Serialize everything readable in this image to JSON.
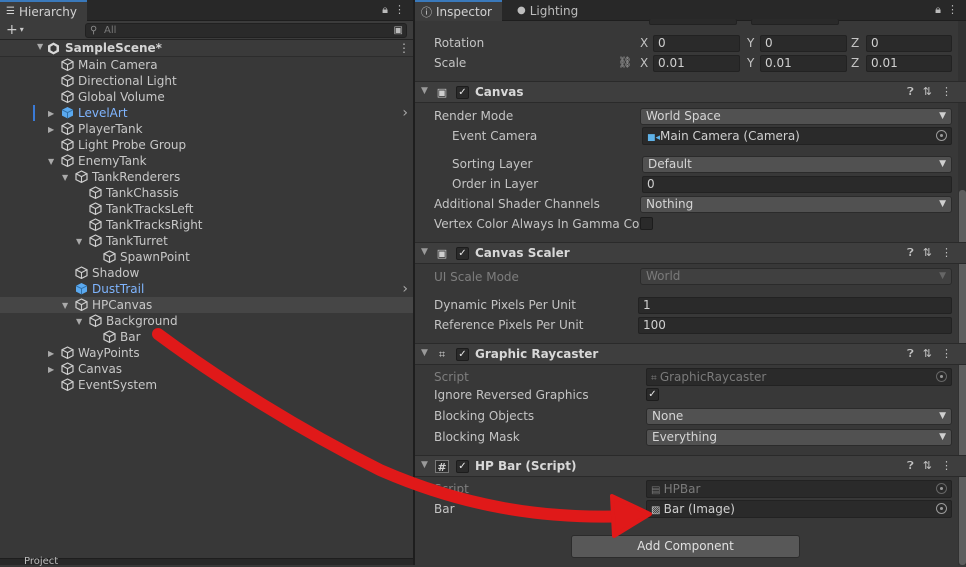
{
  "hierarchy": {
    "tab_label": "Hierarchy",
    "search_placeholder": "All",
    "scene_name": "SampleScene*",
    "items": [
      {
        "label": "Main Camera",
        "depth": 0,
        "arrow": "",
        "color": "normal",
        "selected": false,
        "prefab": false
      },
      {
        "label": "Directional Light",
        "depth": 0,
        "arrow": "",
        "color": "normal",
        "selected": false,
        "prefab": false
      },
      {
        "label": "Global Volume",
        "depth": 0,
        "arrow": "",
        "color": "normal",
        "selected": false,
        "prefab": false
      },
      {
        "label": "LevelArt",
        "depth": 0,
        "arrow": "right",
        "color": "blue",
        "selected": false,
        "prefab": true
      },
      {
        "label": "PlayerTank",
        "depth": 0,
        "arrow": "right",
        "color": "normal",
        "selected": false,
        "prefab": false
      },
      {
        "label": "Light Probe Group",
        "depth": 0,
        "arrow": "",
        "color": "normal",
        "selected": false,
        "prefab": false
      },
      {
        "label": "EnemyTank",
        "depth": 0,
        "arrow": "down",
        "color": "normal",
        "selected": false,
        "prefab": false
      },
      {
        "label": "TankRenderers",
        "depth": 1,
        "arrow": "down",
        "color": "normal",
        "selected": false,
        "prefab": false
      },
      {
        "label": "TankChassis",
        "depth": 2,
        "arrow": "",
        "color": "normal",
        "selected": false,
        "prefab": false
      },
      {
        "label": "TankTracksLeft",
        "depth": 2,
        "arrow": "",
        "color": "normal",
        "selected": false,
        "prefab": false
      },
      {
        "label": "TankTracksRight",
        "depth": 2,
        "arrow": "",
        "color": "normal",
        "selected": false,
        "prefab": false
      },
      {
        "label": "TankTurret",
        "depth": 2,
        "arrow": "down",
        "color": "normal",
        "selected": false,
        "prefab": false
      },
      {
        "label": "SpawnPoint",
        "depth": 3,
        "arrow": "",
        "color": "normal",
        "selected": false,
        "prefab": false
      },
      {
        "label": "Shadow",
        "depth": 1,
        "arrow": "",
        "color": "normal",
        "selected": false,
        "prefab": false
      },
      {
        "label": "DustTrail",
        "depth": 1,
        "arrow": "",
        "color": "blue",
        "selected": false,
        "prefab": true
      },
      {
        "label": "HPCanvas",
        "depth": 1,
        "arrow": "down",
        "color": "normal",
        "selected": true,
        "prefab": false
      },
      {
        "label": "Background",
        "depth": 2,
        "arrow": "down",
        "color": "normal",
        "selected": false,
        "prefab": false
      },
      {
        "label": "Bar",
        "depth": 3,
        "arrow": "",
        "color": "normal",
        "selected": false,
        "prefab": false
      },
      {
        "label": "WayPoints",
        "depth": 0,
        "arrow": "right",
        "color": "normal",
        "selected": false,
        "prefab": false
      },
      {
        "label": "Canvas",
        "depth": 0,
        "arrow": "right",
        "color": "normal",
        "selected": false,
        "prefab": false
      },
      {
        "label": "EventSystem",
        "depth": 0,
        "arrow": "",
        "color": "normal",
        "selected": false,
        "prefab": false
      }
    ],
    "bottom_tab": "Project"
  },
  "inspector": {
    "tab_inspector": "Inspector",
    "tab_lighting": "Lighting",
    "transform": {
      "rotation_label": "Rotation",
      "scale_label": "Scale",
      "rotation": {
        "x": "0",
        "y": "0",
        "z": "0"
      },
      "scale": {
        "x": "0.01",
        "y": "0.01",
        "z": "0.01"
      },
      "axis_x": "X",
      "axis_y": "Y",
      "axis_z": "Z"
    },
    "canvas": {
      "title": "Canvas",
      "render_mode_label": "Render Mode",
      "render_mode": "World Space",
      "event_camera_label": "Event Camera",
      "event_camera": "Main Camera (Camera)",
      "sorting_layer_label": "Sorting Layer",
      "sorting_layer": "Default",
      "order_label": "Order in Layer",
      "order": "0",
      "shader_channels_label": "Additional Shader Channels",
      "shader_channels": "Nothing",
      "vertex_color_label": "Vertex Color Always In Gamma Color"
    },
    "canvas_scaler": {
      "title": "Canvas Scaler",
      "ui_scale_label": "UI Scale Mode",
      "ui_scale": "World",
      "dynamic_label": "Dynamic Pixels Per Unit",
      "dynamic": "1",
      "reference_label": "Reference Pixels Per Unit",
      "reference": "100"
    },
    "raycaster": {
      "title": "Graphic Raycaster",
      "script_label": "Script",
      "script": "GraphicRaycaster",
      "ignore_label": "Ignore Reversed Graphics",
      "blocking_objects_label": "Blocking Objects",
      "blocking_objects": "None",
      "blocking_mask_label": "Blocking Mask",
      "blocking_mask": "Everything"
    },
    "hpbar": {
      "title": "HP Bar (Script)",
      "script_label": "Script",
      "script": "HPBar",
      "bar_label": "Bar",
      "bar": "Bar (Image)"
    },
    "add_component": "Add Component"
  },
  "colors": {
    "annotation_arrow": "#e01919",
    "prefab_blue": "#7fb5ff",
    "selection": "#464646",
    "tab_accent": "#3a79bb"
  }
}
